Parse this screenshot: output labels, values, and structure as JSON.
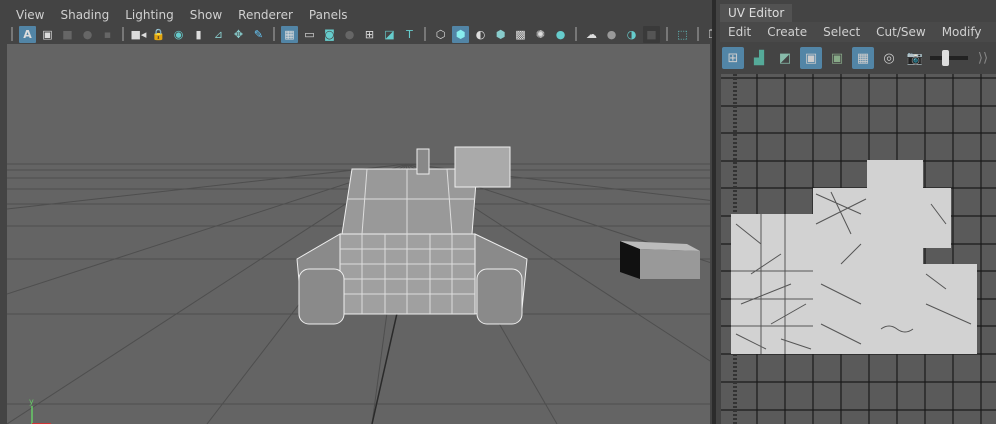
{
  "viewport": {
    "menu": [
      "View",
      "Shading",
      "Lighting",
      "Show",
      "Renderer",
      "Panels"
    ],
    "toolbar_icons": [
      "select-camera-icon",
      "camera-attributes-icon",
      "bookmark-icon",
      "image-plane-icon",
      "2d-pan-zoom-icon",
      "grease-pencil-icon",
      "grid-icon",
      "film-gate-icon",
      "resolution-gate-icon",
      "gate-mask-icon",
      "field-chart-icon",
      "safe-action-icon",
      "safe-title-icon",
      "wireframe-icon",
      "smooth-shade-icon",
      "default-material-icon",
      "wireframe-on-shaded-icon",
      "textured-icon",
      "lights-icon",
      "shadows-icon",
      "screen-space-ao-icon",
      "motion-blur-icon",
      "anti-aliasing-icon",
      "depth-of-field-icon",
      "isolate-select-icon",
      "xray-icon",
      "xray-joints-icon"
    ],
    "axis_labels": [
      "y"
    ]
  },
  "uv_editor": {
    "tab_title": "UV Editor",
    "menu": [
      "Edit",
      "Create",
      "Select",
      "Cut/Sew",
      "Modify"
    ],
    "toolbar_icons": [
      "uv-shell-icon",
      "uv-component-icon",
      "uv-backface-icon",
      "show-uv-borders-icon",
      "uv-distortion-icon",
      "checker-icon",
      "shaded-uv-icon",
      "image-display-icon",
      "brightness-slider",
      "more-icon"
    ]
  },
  "colors": {
    "accent": "#5285a6",
    "viewport_bg": "#646464",
    "uv_bg": "#5a5a5a"
  }
}
